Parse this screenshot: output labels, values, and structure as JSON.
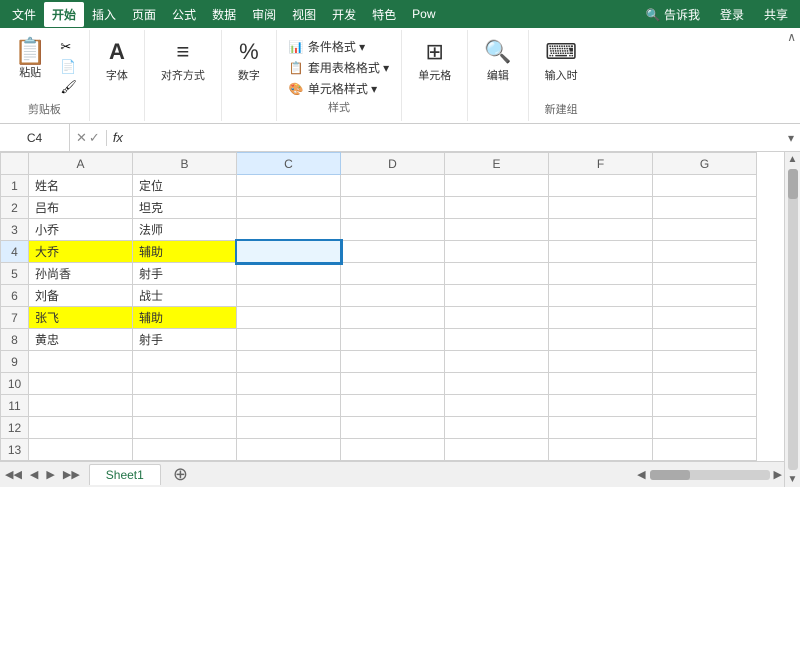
{
  "menubar": {
    "items": [
      "文件",
      "开始",
      "插入",
      "页面",
      "公式",
      "数据",
      "审阅",
      "视图",
      "开发",
      "特色",
      "Pow"
    ],
    "active": "开始",
    "right": [
      "告诉我",
      "登录",
      "共享"
    ]
  },
  "ribbon": {
    "groups": [
      {
        "label": "剪贴板",
        "buttons": [
          {
            "icon": "📋",
            "label": "粘贴"
          },
          {
            "icon": "✂",
            "label": ""
          },
          {
            "icon": "📄",
            "label": ""
          }
        ]
      },
      {
        "label": "字体",
        "buttons": [
          {
            "icon": "A",
            "label": "字体"
          }
        ]
      },
      {
        "label": "对齐方式",
        "buttons": [
          {
            "icon": "≡",
            "label": "对齐方式"
          }
        ]
      },
      {
        "label": "数字",
        "buttons": [
          {
            "icon": "%",
            "label": "数字"
          }
        ]
      },
      {
        "label": "样式",
        "items": [
          "条件格式 ▾",
          "套用表格格式 ▾",
          "单元格样式 ▾"
        ]
      },
      {
        "label": "",
        "buttons": [
          {
            "icon": "⊞",
            "label": "单元格"
          }
        ]
      },
      {
        "label": "",
        "buttons": [
          {
            "icon": "🔍",
            "label": "编辑"
          }
        ]
      },
      {
        "label": "新建组",
        "buttons": [
          {
            "icon": "⌨",
            "label": "输入时"
          }
        ]
      }
    ]
  },
  "formulaBar": {
    "cellRef": "C4",
    "fx": "fx"
  },
  "spreadsheet": {
    "columns": [
      "A",
      "B",
      "C",
      "D",
      "E",
      "F",
      "G"
    ],
    "rows": [
      {
        "num": 1,
        "cells": [
          "姓名",
          "定位",
          "",
          "",
          "",
          "",
          ""
        ]
      },
      {
        "num": 2,
        "cells": [
          "吕布",
          "坦克",
          "",
          "",
          "",
          "",
          ""
        ]
      },
      {
        "num": 3,
        "cells": [
          "小乔",
          "法师",
          "",
          "",
          "",
          "",
          ""
        ]
      },
      {
        "num": 4,
        "cells": [
          "大乔",
          "辅助",
          "",
          "",
          "",
          "",
          ""
        ],
        "highlight": true
      },
      {
        "num": 5,
        "cells": [
          "孙尚香",
          "射手",
          "",
          "",
          "",
          "",
          ""
        ]
      },
      {
        "num": 6,
        "cells": [
          "刘备",
          "战士",
          "",
          "",
          "",
          "",
          ""
        ]
      },
      {
        "num": 7,
        "cells": [
          "张飞",
          "辅助",
          "",
          "",
          "",
          "",
          ""
        ],
        "highlight": true
      },
      {
        "num": 8,
        "cells": [
          "黄忠",
          "射手",
          "",
          "",
          "",
          "",
          ""
        ]
      },
      {
        "num": 9,
        "cells": [
          "",
          "",
          "",
          "",
          "",
          "",
          ""
        ]
      },
      {
        "num": 10,
        "cells": [
          "",
          "",
          "",
          "",
          "",
          "",
          ""
        ]
      },
      {
        "num": 11,
        "cells": [
          "",
          "",
          "",
          "",
          "",
          "",
          ""
        ]
      },
      {
        "num": 12,
        "cells": [
          "",
          "",
          "",
          "",
          "",
          "",
          ""
        ]
      },
      {
        "num": 13,
        "cells": [
          "",
          "",
          "",
          "",
          "",
          "",
          ""
        ]
      }
    ],
    "selectedCell": "C4",
    "selectedRow": 4,
    "selectedCol": "C"
  },
  "tabs": {
    "sheets": [
      "Sheet1"
    ],
    "active": "Sheet1"
  }
}
